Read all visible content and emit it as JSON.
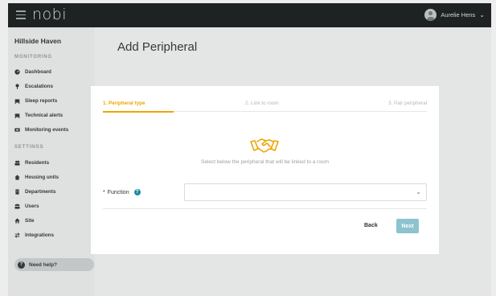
{
  "header": {
    "logo": "nobi",
    "user_name": "Aurelie Hens"
  },
  "sidebar": {
    "site_name": "Hillside Haven",
    "monitoring_label": "MONITORING",
    "monitoring_items": [
      {
        "label": "Dashboard",
        "icon": "dashboard-icon"
      },
      {
        "label": "Escalations",
        "icon": "pin-icon"
      },
      {
        "label": "Sleep reports",
        "icon": "bed-icon"
      },
      {
        "label": "Technical alerts",
        "icon": "alert-icon"
      },
      {
        "label": "Monitoring events",
        "icon": "events-icon"
      }
    ],
    "settings_label": "SETTINGS",
    "settings_items": [
      {
        "label": "Residents",
        "icon": "residents-icon"
      },
      {
        "label": "Housing units",
        "icon": "housing-icon"
      },
      {
        "label": "Departments",
        "icon": "department-icon"
      },
      {
        "label": "Users",
        "icon": "users-icon"
      },
      {
        "label": "Site",
        "icon": "home-icon"
      },
      {
        "label": "Integrations",
        "icon": "integrations-icon"
      }
    ],
    "help_label": "Need help?"
  },
  "page": {
    "title": "Add Peripheral"
  },
  "modal": {
    "steps": [
      "1. Peripheral type",
      "2. Link to room",
      "3. Pair peripheral"
    ],
    "active_step": 1,
    "hint": "Select below the peripheral that will be linked to a room",
    "function_label": "Function",
    "required_mark": "*",
    "function_value": "",
    "back_label": "Back",
    "next_label": "Next"
  },
  "colors": {
    "accent": "#f0a400",
    "topbar": "#1f2222",
    "next_button": "#8cc3cf",
    "help_icon": "#1f8ba0"
  }
}
